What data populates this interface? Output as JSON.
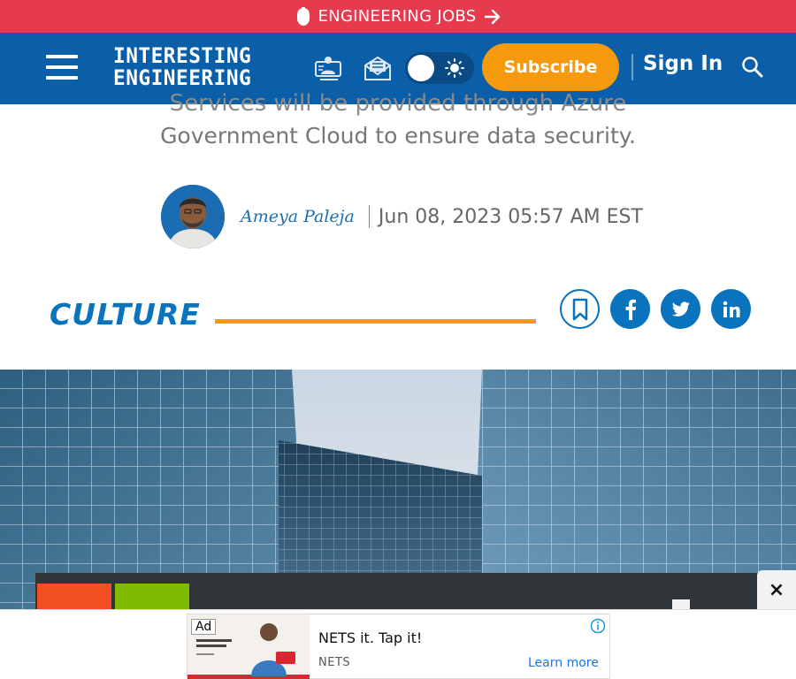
{
  "jobs_banner": {
    "label": "ENGINEERING JOBS"
  },
  "header": {
    "logo_line1": "INTERESTING",
    "logo_line2": "ENGINEERING",
    "subscribe_label": "Subscribe",
    "signin_label": "Sign In",
    "icons": [
      "menu-icon",
      "webinar-icon",
      "newsletter-icon",
      "theme-toggle",
      "search-icon"
    ]
  },
  "article": {
    "subtitle_cut": "Services will be provided through Azure",
    "subtitle": "Government Cloud to ensure data security.",
    "author": "Ameya Paleja",
    "date": "Jun 08, 2023 05:57 AM EST",
    "category": "CULTURE"
  },
  "share": {
    "icons": [
      "bookmark-icon",
      "facebook-icon",
      "twitter-icon",
      "linkedin-icon"
    ]
  },
  "ad": {
    "tag": "Ad",
    "title": "NETS it. Tap it!",
    "brand": "NETS",
    "cta": "Learn more",
    "close": "×"
  },
  "colors": {
    "jobs_bar": "#e63a4f",
    "header": "#0a5fa8",
    "accent": "#f59a0c",
    "brand_blue": "#0a73bd"
  }
}
